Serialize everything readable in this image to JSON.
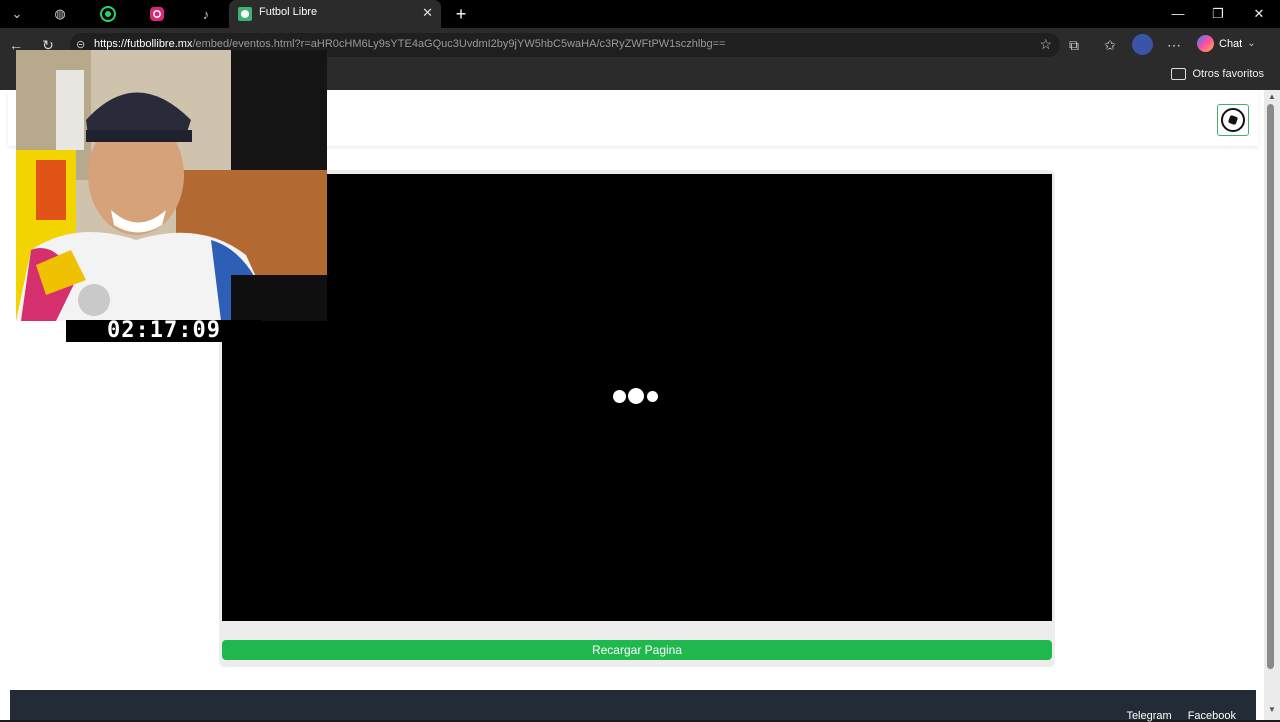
{
  "browser": {
    "active_tab": {
      "title": "Futbol Libre"
    },
    "address_bar": {
      "url_host": "https://futbollibre.mx",
      "url_path": "/embed/eventos.html?r=aHR0cHM6Ly9sYTE4aGQuc3UvdmI2by9jYW5hbC5waHA/c3RyZWFtPW1sczhlbg=="
    },
    "chat_label": "Chat",
    "favorites_folder": "Otros favoritos",
    "window_controls": {
      "minimize": "—",
      "restore": "❐",
      "close": "✕"
    }
  },
  "page": {
    "reload_button": "Recargar Pagina",
    "footer_links": [
      "Telegram",
      "Facebook"
    ]
  },
  "overlay": {
    "timer": "02:17:09"
  },
  "icons": {
    "tab_search": "chevron-down-icon",
    "tab_pinned": [
      "globe-icon",
      "whatsapp-icon",
      "instagram-icon",
      "tiktok-icon"
    ],
    "new_tab": "plus-icon",
    "back": "back-arrow-icon",
    "reload": "reload-icon",
    "site_info": "site-info-icon",
    "favorite": "star-icon",
    "extensions": "extensions-icon",
    "favorites": "favorites-icon",
    "profile": "avatar",
    "more": "more-icon",
    "copilot": "copilot-icon"
  },
  "colors": {
    "accent_green": "#1fb84c",
    "player_bg": "#000000",
    "footer_bg": "#222b36"
  }
}
